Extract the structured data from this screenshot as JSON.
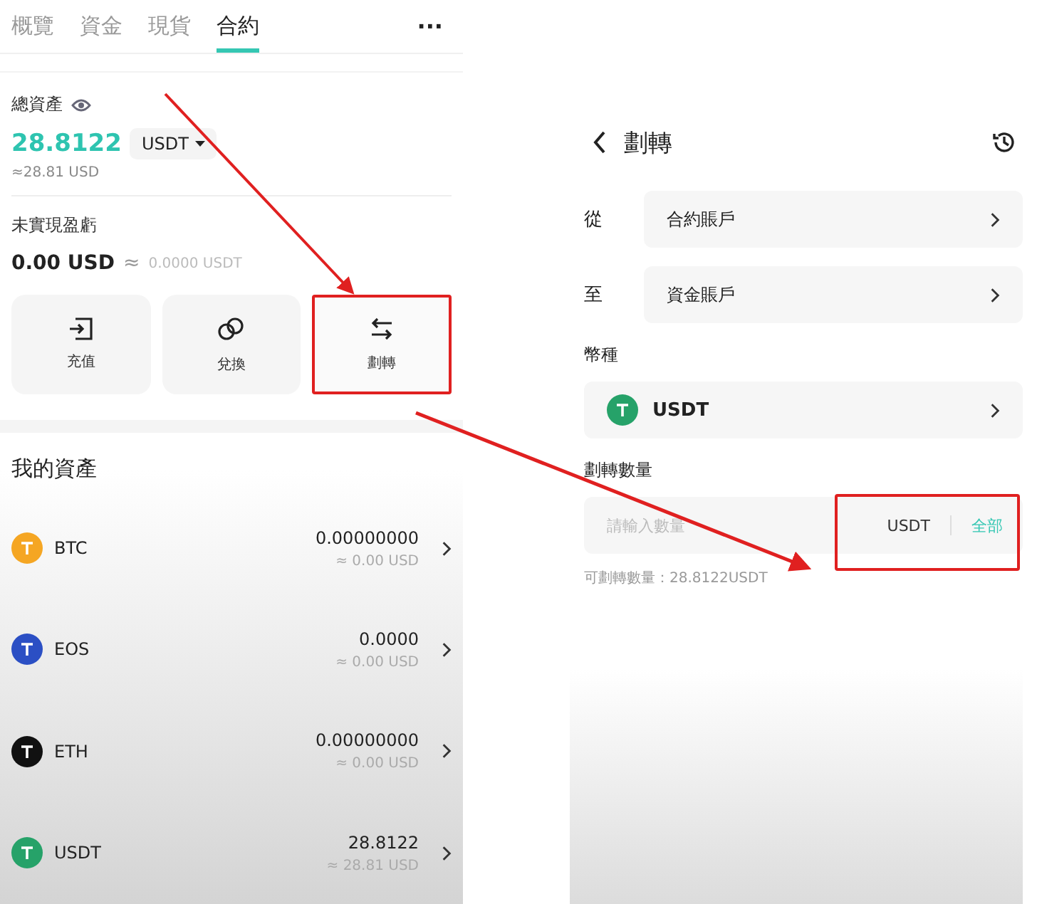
{
  "left_screen": {
    "tabs": [
      {
        "label": "概覽",
        "selected": false
      },
      {
        "label": "資金",
        "selected": false
      },
      {
        "label": "現貨",
        "selected": false
      },
      {
        "label": "合約",
        "selected": true
      }
    ],
    "more_menu": "···",
    "summary": {
      "total_label": "總資產",
      "total_value": "28.8122",
      "currency": "USDT",
      "total_usd": "≈28.81 USD",
      "pnl_label": "未實現盈虧",
      "pnl_value": "0.00 USD",
      "pnl_approx": "≈",
      "pnl_usdt": "0.0000 USDT"
    },
    "actions": [
      {
        "label": "充值",
        "kind": "deposit",
        "highlighted": false
      },
      {
        "label": "兌換",
        "kind": "convert",
        "highlighted": false
      },
      {
        "label": "劃轉",
        "kind": "transfer",
        "highlighted": true
      }
    ],
    "assets_title": "我的資產",
    "assets": [
      {
        "symbol": "BTC",
        "amount": "0.00000000",
        "usd": "≈ 0.00 USD",
        "color": "#f5a623"
      },
      {
        "symbol": "EOS",
        "amount": "0.0000",
        "usd": "≈ 0.00 USD",
        "color": "#2b4fc4"
      },
      {
        "symbol": "ETH",
        "amount": "0.00000000",
        "usd": "≈ 0.00 USD",
        "color": "#111111"
      },
      {
        "symbol": "USDT",
        "amount": "28.8122",
        "usd": "≈ 28.81 USD",
        "color": "#26a269"
      }
    ]
  },
  "right_screen": {
    "title": "劃轉",
    "from": {
      "label": "從",
      "value": "合約賬戶"
    },
    "to": {
      "label": "至",
      "value": "資金賬戶"
    },
    "coin_label": "幣種",
    "coin": "USDT",
    "amount_label": "劃轉數量",
    "amount_placeholder": "請輸入數量",
    "amount_unit": "USDT",
    "max_button": "全部",
    "amount_highlighted": true,
    "available": "可劃轉數量：28.8122USDT"
  }
}
